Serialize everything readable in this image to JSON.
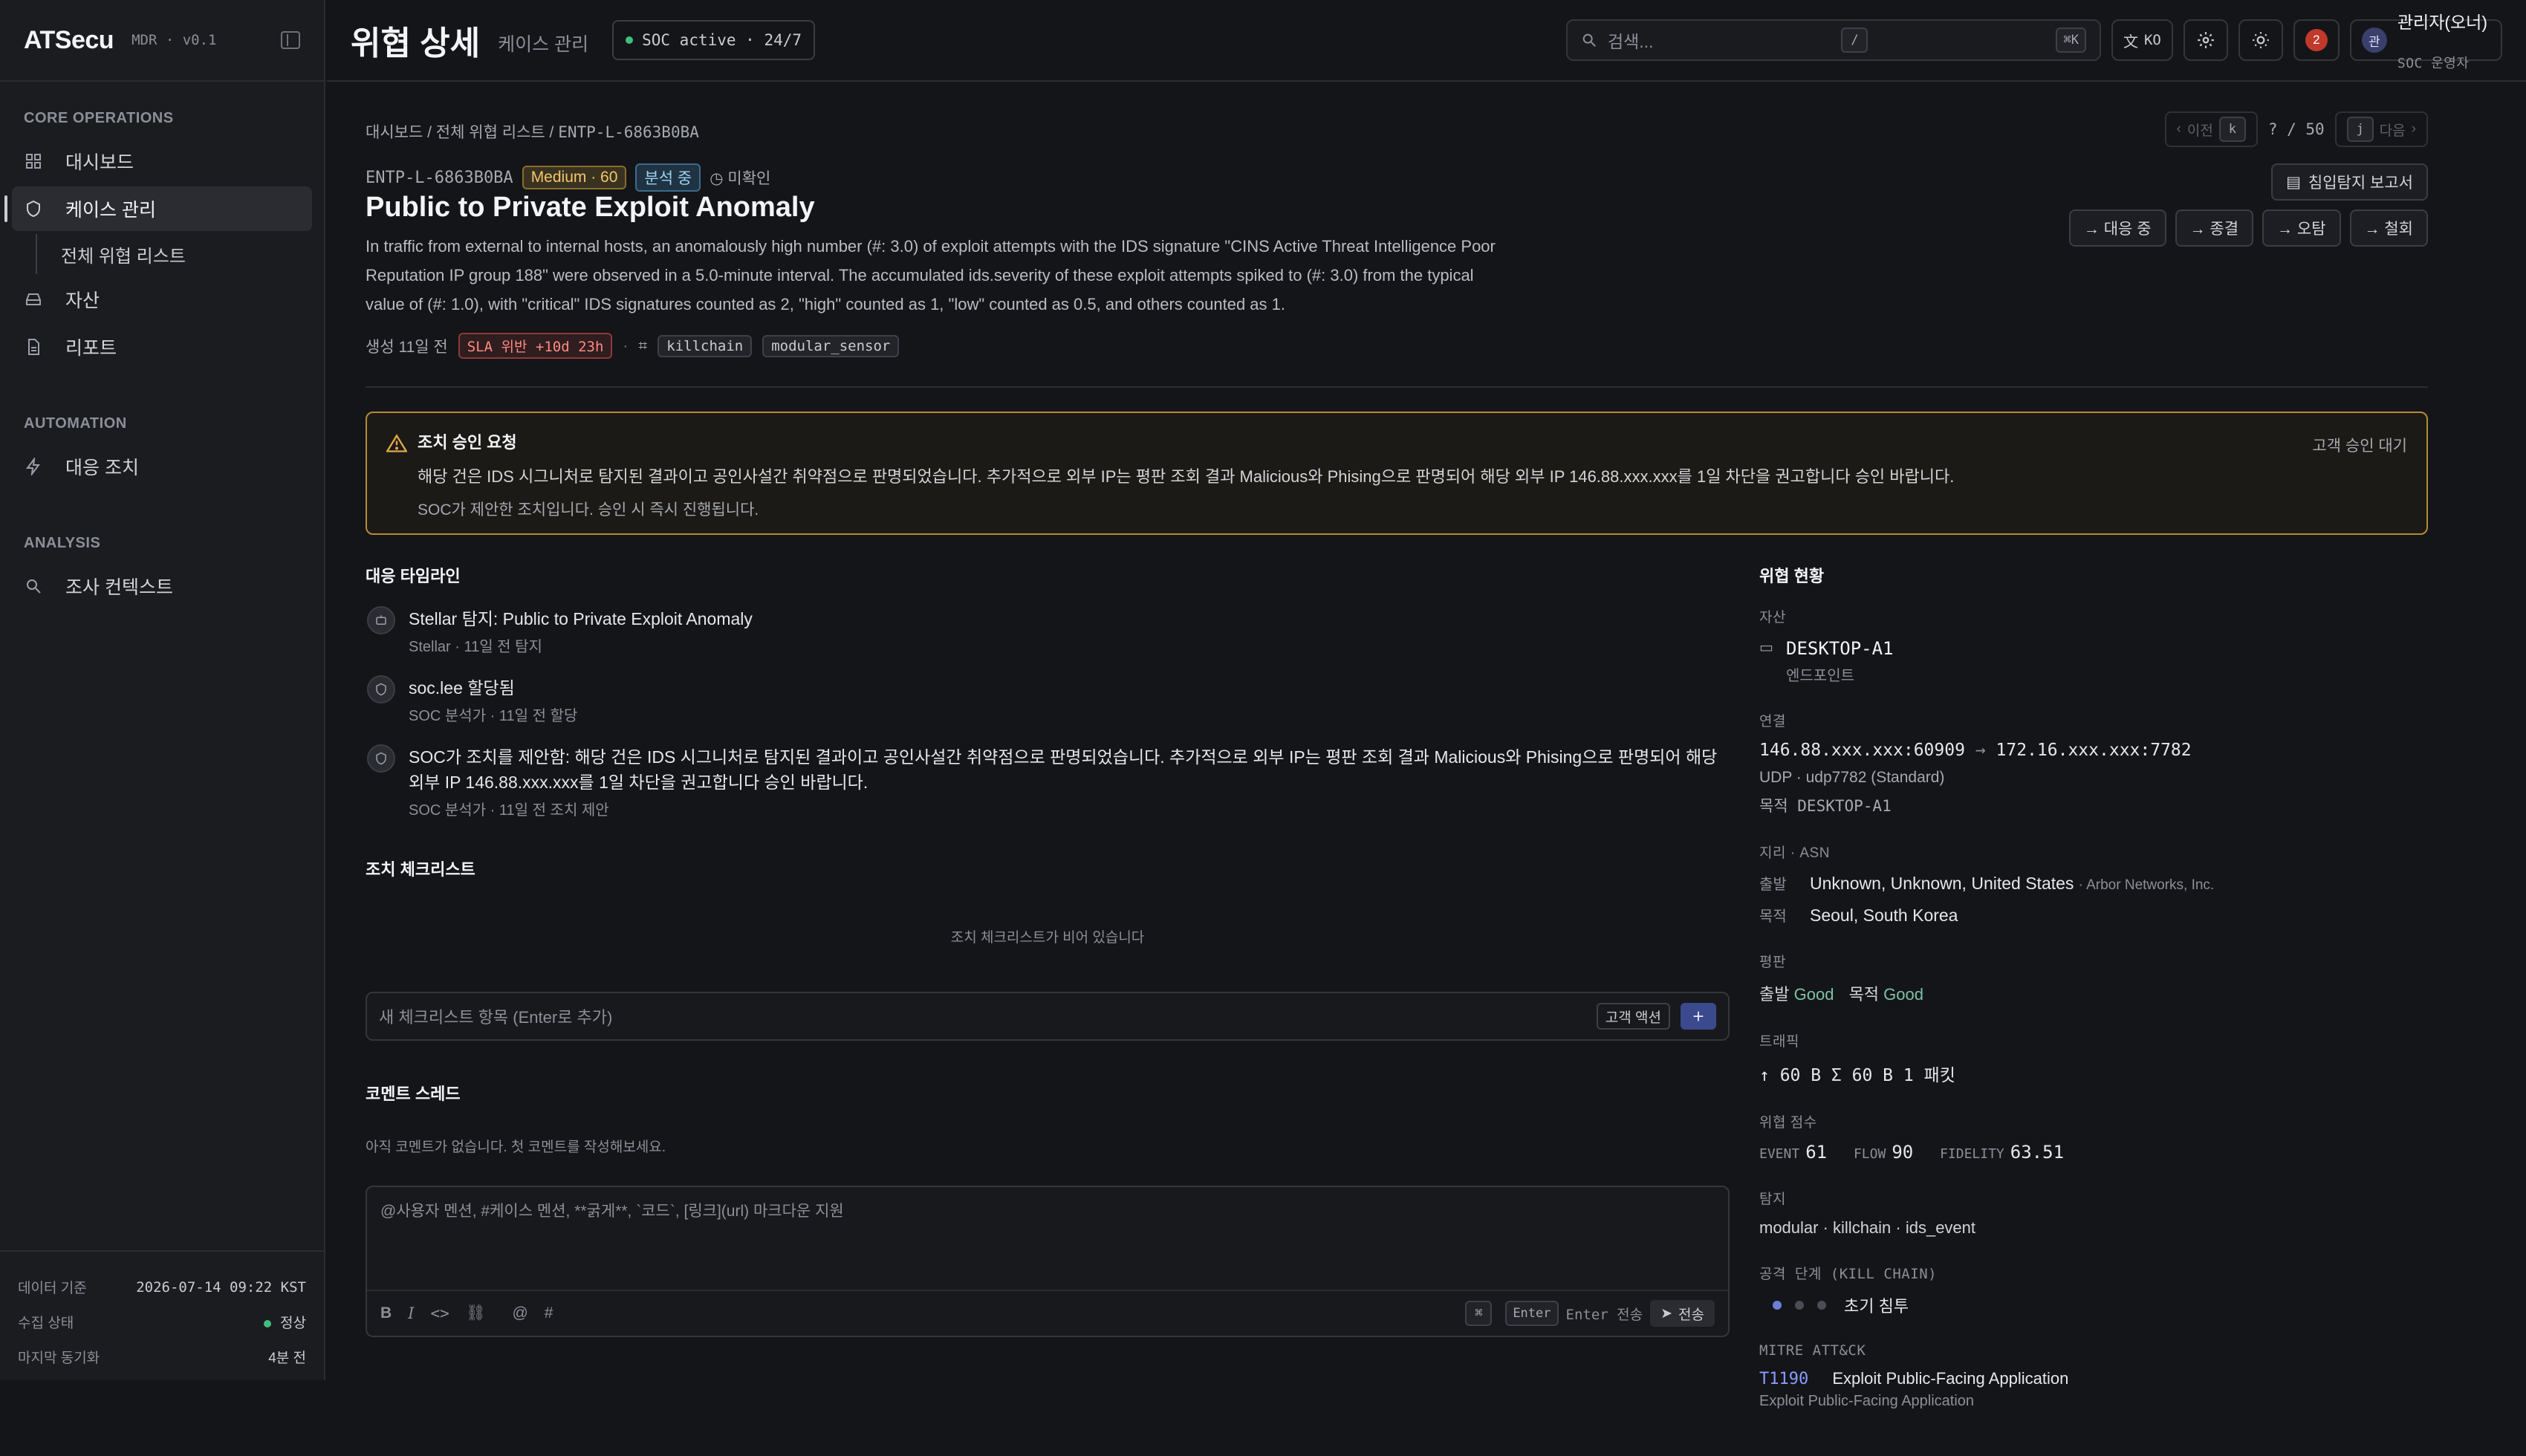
{
  "sidebar": {
    "brand": "ATSecu",
    "version": "MDR · v0.1",
    "sections": [
      {
        "title": "CORE OPERATIONS"
      },
      {
        "title": "AUTOMATION"
      },
      {
        "title": "ANALYSIS"
      }
    ],
    "items": {
      "dashboard": "대시보드",
      "cases": "케이스 관리",
      "all_threats": "전체 위협 리스트",
      "assets": "자산",
      "reports": "리포트",
      "response": "대응 조치",
      "investigation": "조사 컨텍스트"
    },
    "footer": {
      "data_basis_label": "데이터 기준",
      "data_basis_value": "2026-07-14 09:22 KST",
      "collect_label": "수집 상태",
      "collect_value": "정상",
      "sync_label": "마지막 동기화",
      "sync_value": "4분 전"
    }
  },
  "header": {
    "title": "위협 상세",
    "crumb": "케이스 관리",
    "soc_status": "SOC active · 24/7",
    "search_placeholder": "검색...",
    "kbd_slash": "/",
    "kbd_cmdk": "⌘K",
    "lang": "KO",
    "notif_count": "2",
    "user_avatar": "관",
    "user_name": "관리자(오너)",
    "user_role": "SOC 운영자"
  },
  "breadcrumb": [
    "대시보드",
    "전체 위협 리스트",
    "ENTP-L-6863B0BA"
  ],
  "pager": {
    "prev": "이전",
    "prev_key": "k",
    "position": "? / 50",
    "next_key": "j",
    "next": "다음"
  },
  "case": {
    "id": "ENTP-L-6863B0BA",
    "severity": "Medium · 60",
    "status": "분석 중",
    "confirm": "미확인",
    "title": "Public to Private Exploit Anomaly",
    "description": "In traffic from external to internal hosts, an anomalously high number (#: 3.0) of exploit attempts with the IDS signature \"CINS Active Threat Intelligence Poor Reputation IP group 188\" were observed in a 5.0-minute interval. The accumulated ids.severity of these exploit attempts spiked to (#: 3.0) from the typical value of (#: 1.0), with \"critical\" IDS signatures counted as 2, \"high\" counted as 1, \"low\" counted as 0.5, and others counted as 1.",
    "created": "생성 11일 전",
    "sla": "SLA 위반 +10d 23h",
    "tags": [
      "killchain",
      "modular_sensor"
    ]
  },
  "actions": {
    "report": "침입탐지 보고서",
    "in_response": "→ 대응 중",
    "close": "→ 종결",
    "false_positive": "→ 오탐",
    "withdraw": "→ 철회"
  },
  "approval": {
    "title": "조치 승인 요청",
    "body": "해당 건은 IDS 시그니처로 탐지된 결과이고 공인사설간 취약점으로 판명되었습니다. 추가적으로 외부 IP는 평판 조회 결과 Malicious와 Phising으로 판명되어 해당 외부 IP 146.88.xxx.xxx를 1일 차단을 권고합니다 승인 바랍니다.",
    "sub": "SOC가 제안한 조치입니다. 승인 시 즉시 진행됩니다.",
    "state": "고객 승인 대기"
  },
  "timeline": {
    "title": "대응 타임라인",
    "items": [
      {
        "text": "Stellar 탐지: Public to Private Exploit Anomaly",
        "meta": "Stellar · 11일 전 탐지"
      },
      {
        "text": "soc.lee 할당됨",
        "meta": "SOC 분석가 · 11일 전 할당"
      },
      {
        "text": "SOC가 조치를 제안함: 해당 건은 IDS 시그니처로 탐지된 결과이고 공인사설간 취약점으로 판명되었습니다. 추가적으로 외부 IP는 평판 조회 결과 Malicious와 Phising으로 판명되어 해당 외부 IP 146.88.xxx.xxx를 1일 차단을 권고합니다 승인 바랍니다.",
        "meta": "SOC 분석가 · 11일 전 조치 제안"
      }
    ]
  },
  "checklist": {
    "title": "조치 체크리스트",
    "empty": "조치 체크리스트가 비어 있습니다",
    "placeholder": "새 체크리스트 항목 (Enter로 추가)",
    "customer_action": "고객 액션",
    "add": "+"
  },
  "comments": {
    "title": "코멘트 스레드",
    "empty": "아직 코멘트가 없습니다. 첫 코멘트를 작성해보세요.",
    "placeholder": "@사용자 멘션, #케이스 멘션, **굵게**, `코드`, [링크](url) 마크다운 지원",
    "kbd_cmd": "⌘",
    "kbd_enter": "Enter",
    "send_hint": "Enter 전송",
    "send": "전송"
  },
  "threat": {
    "title": "위협 현황",
    "asset_label": "자산",
    "asset_name": "DESKTOP-A1",
    "asset_type": "엔드포인트",
    "conn_label": "연결",
    "src": "146.88.xxx.xxx:60909",
    "dst": "172.16.xxx.xxx:7782",
    "proto": "UDP · udp7782 (Standard)",
    "target": "목적 DESKTOP-A1",
    "geo_label": "지리 · ASN",
    "origin_k": "출발",
    "origin_v": "Unknown, Unknown, United States",
    "origin_asn": "· Arbor Networks, Inc.",
    "dest_k": "목적",
    "dest_v": "Seoul, South Korea",
    "rep_label": "평판",
    "rep_origin": "출발",
    "rep_origin_v": "Good",
    "rep_dest": "목적",
    "rep_dest_v": "Good",
    "traffic_label": "트래픽",
    "traffic": "↑ 60 B  Σ 60 B  1 패킷",
    "score_label": "위협 점수",
    "event_k": "EVENT",
    "event_v": "61",
    "flow_k": "FLOW",
    "flow_v": "90",
    "fid_k": "FIDELITY",
    "fid_v": "63.51",
    "detect_label": "탐지",
    "detect": "modular · killchain · ids_event",
    "kc_label": "공격 단계 (KILL CHAIN)",
    "kc_stage": "초기 침투",
    "mitre_label": "MITRE ATT&CK",
    "tech_id": "T1190",
    "tech_name": "Exploit Public-Facing Application",
    "tech_sub": "Exploit Public-Facing Application"
  }
}
